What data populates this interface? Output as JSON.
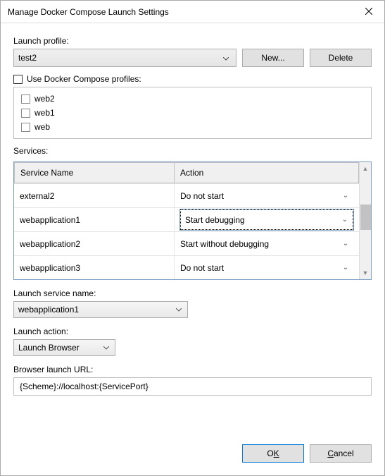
{
  "window": {
    "title": "Manage Docker Compose Launch Settings"
  },
  "labels": {
    "launch_profile": "Launch profile:",
    "use_profiles": "Use Docker Compose profiles:",
    "services": "Services:",
    "launch_service_name": "Launch service name:",
    "launch_action": "Launch action:",
    "browser_url": "Browser launch URL:"
  },
  "profile_dropdown": {
    "selected": "test2"
  },
  "buttons": {
    "new": "New...",
    "delete": "Delete",
    "ok_pre": "O",
    "ok_key": "K",
    "cancel_key": "C",
    "cancel_rest": "ancel"
  },
  "compose_profiles": [
    {
      "name": "web2"
    },
    {
      "name": "web1"
    },
    {
      "name": "web"
    }
  ],
  "services_table": {
    "header_name": "Service Name",
    "header_action": "Action",
    "rows": [
      {
        "name": "external2",
        "action": "Do not start",
        "focused": false
      },
      {
        "name": "webapplication1",
        "action": "Start debugging",
        "focused": true
      },
      {
        "name": "webapplication2",
        "action": "Start without debugging",
        "focused": false
      },
      {
        "name": "webapplication3",
        "action": "Do not start",
        "focused": false
      }
    ]
  },
  "launch_service": {
    "selected": "webapplication1"
  },
  "launch_action": {
    "selected": "Launch Browser"
  },
  "browser_url": {
    "value": "{Scheme}://localhost:{ServicePort}"
  }
}
